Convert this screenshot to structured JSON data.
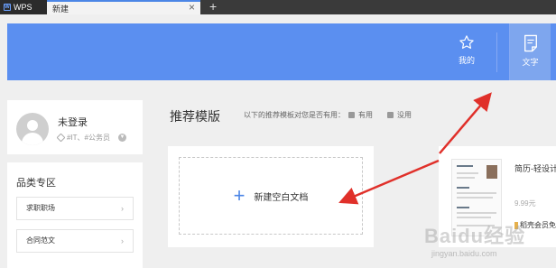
{
  "tabs": {
    "app_label": "WPS",
    "active_label": "新建",
    "close_glyph": "×",
    "add_glyph": "+"
  },
  "header": {
    "mine_label": "我的",
    "mine_icon": "star-icon",
    "doc_label": "文字",
    "doc_icon": "document-icon",
    "accent": "#5b8ff0"
  },
  "user": {
    "name": "未登录",
    "tags": "#IT、#公务员"
  },
  "categories": {
    "title": "品类专区",
    "items": [
      {
        "label": "求职职场"
      },
      {
        "label": "合同范文"
      }
    ]
  },
  "recommend": {
    "title": "推荐模版",
    "question": "以下的推荐模板对您是否有用：",
    "useful": "有用",
    "useless": "没用"
  },
  "new_blank": {
    "label": "新建空白文档"
  },
  "template": {
    "name": "简历-轻设计",
    "price": "9.99元",
    "badge": "稻壳会员免"
  },
  "watermark": {
    "text": "Baidu经验",
    "sub": "jingyan.baidu.com"
  },
  "annotation_color": "#e0302a"
}
